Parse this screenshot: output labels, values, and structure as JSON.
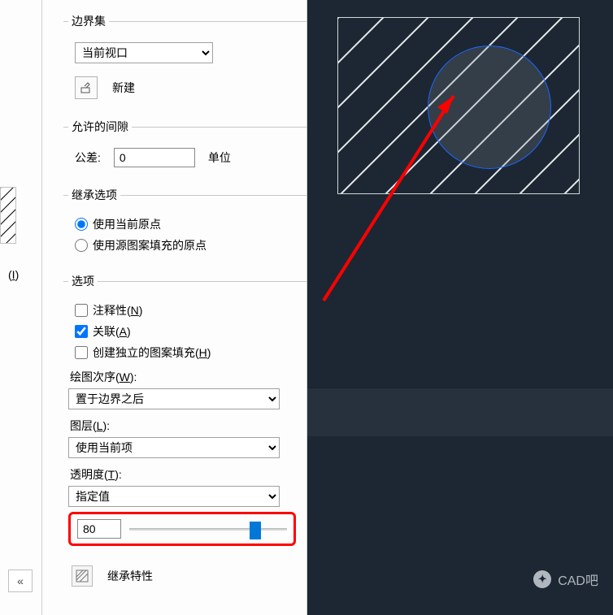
{
  "left_strip": {
    "label_html": "(I)",
    "collapse_icon": "«"
  },
  "boundary_set": {
    "legend": "边界集",
    "viewport_select": "当前视口",
    "new_button_label": "新建"
  },
  "gap_tolerance": {
    "legend": "允许的间隙",
    "label": "公差:",
    "value": "0",
    "unit": "单位"
  },
  "inherit_options": {
    "legend": "继承选项",
    "use_current_origin": "使用当前原点",
    "use_source_origin": "使用源图案填充的原点",
    "selected": "use_current_origin"
  },
  "options": {
    "legend": "选项",
    "annotative": {
      "label": "注释性(N)",
      "checked": false
    },
    "associative": {
      "label": "关联(A)",
      "checked": true
    },
    "independent": {
      "label": "创建独立的图案填充(H)",
      "checked": false
    },
    "draw_order_label": "绘图次序(W):",
    "draw_order_value": "置于边界之后",
    "layer_label": "图层(L):",
    "layer_value": "使用当前项",
    "transparency_label": "透明度(T):",
    "transparency_mode": "指定值",
    "transparency_value": "80",
    "slider_percent": 80
  },
  "inherit_props": {
    "label": "继承特性"
  },
  "watermark": {
    "text": "CAD吧"
  }
}
